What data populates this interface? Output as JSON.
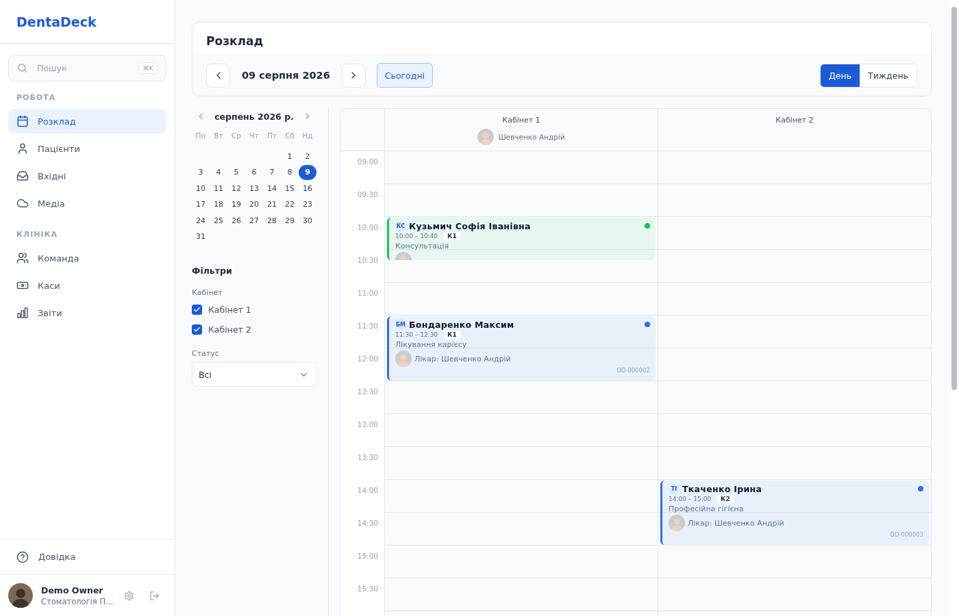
{
  "sidebar": {
    "logo": "DentaDeck",
    "search": {
      "placeholder": "Пошук",
      "shortcut": "⌘K"
    },
    "groups": [
      {
        "title": "РОБОТА",
        "items": [
          {
            "label": "Розклад",
            "selected": true
          },
          {
            "label": "Пацієнти",
            "selected": false
          },
          {
            "label": "Вхідні",
            "selected": false
          },
          {
            "label": "Медіа",
            "selected": false
          }
        ]
      },
      {
        "title": "КЛІНІКА",
        "items": [
          {
            "label": "Команда",
            "selected": false
          },
          {
            "label": "Каси",
            "selected": false
          },
          {
            "label": "Звіти",
            "selected": false
          }
        ]
      }
    ],
    "help": "Довідка",
    "user": {
      "name": "Demo Owner",
      "org": "Стоматологія П..."
    }
  },
  "page": {
    "title": "Розклад",
    "date": "09 серпня 2026",
    "today": "Сьогодні",
    "views": [
      {
        "label": "День",
        "selected": true
      },
      {
        "label": "Тиждень",
        "selected": false
      }
    ]
  },
  "mini_calendar": {
    "month": "серпень 2026 р.",
    "weekdays": [
      "Пн",
      "Вт",
      "Ср",
      "Чт",
      "Пт",
      "Сб",
      "Нд"
    ],
    "weeks": [
      [
        {
          "label": "1",
          "selected": false
        },
        {
          "label": "2",
          "selected": false
        }
      ],
      [
        {
          "label": "3",
          "selected": false
        },
        {
          "label": "4",
          "selected": false
        },
        {
          "label": "5",
          "selected": false
        },
        {
          "label": "6",
          "selected": false
        },
        {
          "label": "7",
          "selected": false
        },
        {
          "label": "8",
          "selected": false
        },
        {
          "label": "9",
          "selected": true
        }
      ],
      [
        {
          "label": "10",
          "selected": false
        },
        {
          "label": "11",
          "selected": false
        },
        {
          "label": "12",
          "selected": false
        },
        {
          "label": "13",
          "selected": false
        },
        {
          "label": "14",
          "selected": false
        },
        {
          "label": "15",
          "selected": false
        },
        {
          "label": "16",
          "selected": false
        }
      ],
      [
        {
          "label": "17",
          "selected": false
        },
        {
          "label": "18",
          "selected": false
        },
        {
          "label": "19",
          "selected": false
        },
        {
          "label": "20",
          "selected": false
        },
        {
          "label": "21",
          "selected": false
        },
        {
          "label": "22",
          "selected": false
        },
        {
          "label": "23",
          "selected": false
        }
      ],
      [
        {
          "label": "24",
          "selected": false
        },
        {
          "label": "25",
          "selected": false
        },
        {
          "label": "26",
          "selected": false
        },
        {
          "label": "27",
          "selected": false
        },
        {
          "label": "28",
          "selected": false
        },
        {
          "label": "29",
          "selected": false
        },
        {
          "label": "30",
          "selected": false
        }
      ],
      [
        {
          "label": "31",
          "selected": false
        }
      ]
    ]
  },
  "filters": {
    "title": "Фільтри",
    "cabinet_label": "Кабінет",
    "cabinets": [
      {
        "label": "Кабінет 1",
        "checked": true
      },
      {
        "label": "Кабінет 2",
        "checked": true
      }
    ],
    "status_label": "Статус",
    "status_value": "Всі"
  },
  "schedule": {
    "times": [
      "09:00",
      "09:30",
      "10:00",
      "10:30",
      "11:00",
      "11:30",
      "12:00",
      "12:30",
      "13:00",
      "13:30",
      "14:00",
      "14:30",
      "15:00",
      "15:30"
    ],
    "columns": [
      {
        "title": "Кабінет 1",
        "doctor": "Шевченко Андрій",
        "events": [
          {
            "initials": "КС",
            "name": "Кузьмич Софія Іванівна",
            "time": "10:00 – 10:40",
            "room": "К1",
            "service": "Консультація",
            "color": "#16c454"
          },
          {
            "initials": "БМ",
            "name": "Бондаренко Максим",
            "time": "11:30 – 12:30",
            "room": "К1",
            "service": "Лікування карієсу",
            "color": "#2f6fe8",
            "doctor": "Лікар: Шевченко Андрій",
            "code": "DD-000002"
          }
        ]
      },
      {
        "title": "Кабінет 2",
        "events": [
          {
            "initials": "ТІ",
            "name": "Ткаченко Ірина",
            "time": "14:00 – 15:00",
            "room": "К2",
            "service": "Професійна гігієна",
            "color": "#2f6fe8",
            "doctor": "Лікар: Шевченко Андрій",
            "code": "DD-000003"
          }
        ]
      }
    ]
  }
}
